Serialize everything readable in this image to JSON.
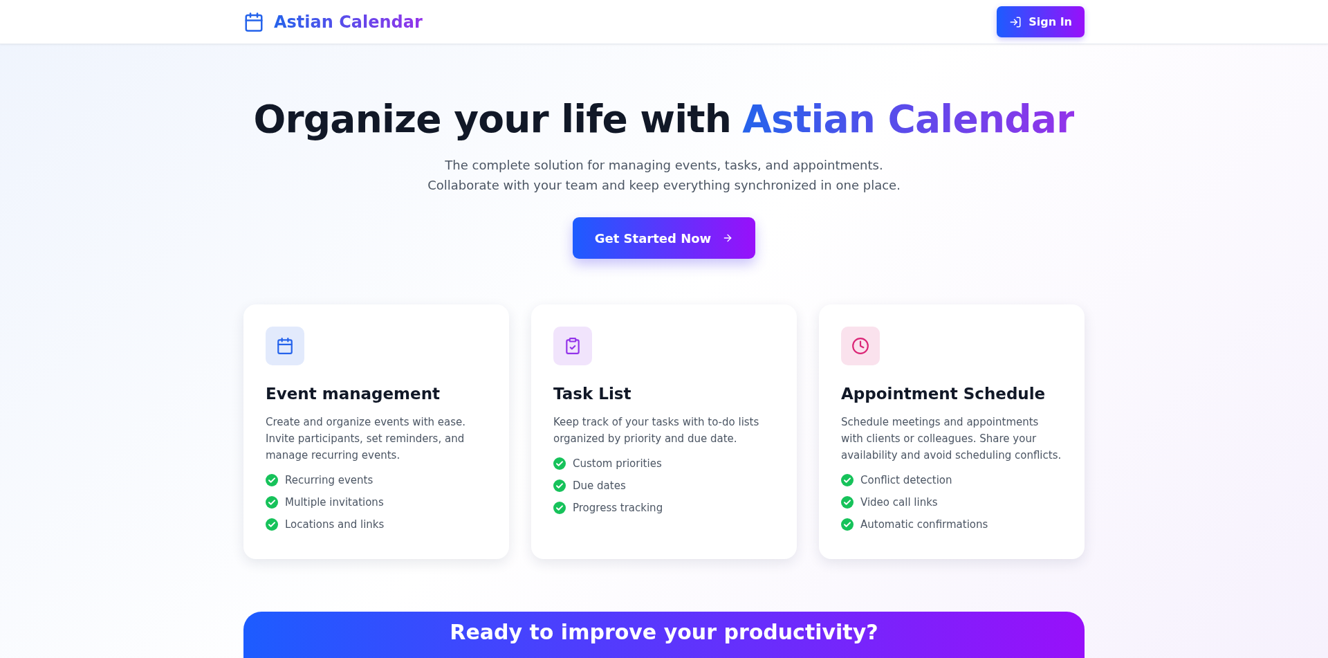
{
  "navbar": {
    "brand": "Astian Calendar",
    "sign_in": "Sign In"
  },
  "hero": {
    "title_lead": "Organize your life with",
    "title_highlight": "Astian Calendar",
    "subtitle_lines": [
      "The complete solution for managing events, tasks, and appointments.",
      "Collaborate with your team and keep everything synchronized in one place."
    ],
    "cta": "Get Started Now"
  },
  "features": [
    {
      "kind": "calendar",
      "color": "#2563eb",
      "title": "Event management",
      "description": "Create and organize events with ease. Invite participants, set reminders, and manage recurring events.",
      "points": [
        "Recurring events",
        "Multiple invitations",
        "Locations and links"
      ]
    },
    {
      "kind": "tasks",
      "color": "#9333ea",
      "title": "Task List",
      "description": "Keep track of your tasks with to-do lists organized by priority and due date.",
      "points": [
        "Custom priorities",
        "Due dates",
        "Progress tracking"
      ]
    },
    {
      "kind": "clock",
      "color": "#db2777",
      "title": "Appointment Schedule",
      "description": "Schedule meetings and appointments with clients or colleagues. Share your availability and avoid scheduling conflicts.",
      "points": [
        "Conflict detection",
        "Video call links",
        "Automatic confirmations"
      ]
    }
  ],
  "banner": {
    "title": "Ready to improve your productivity?"
  }
}
